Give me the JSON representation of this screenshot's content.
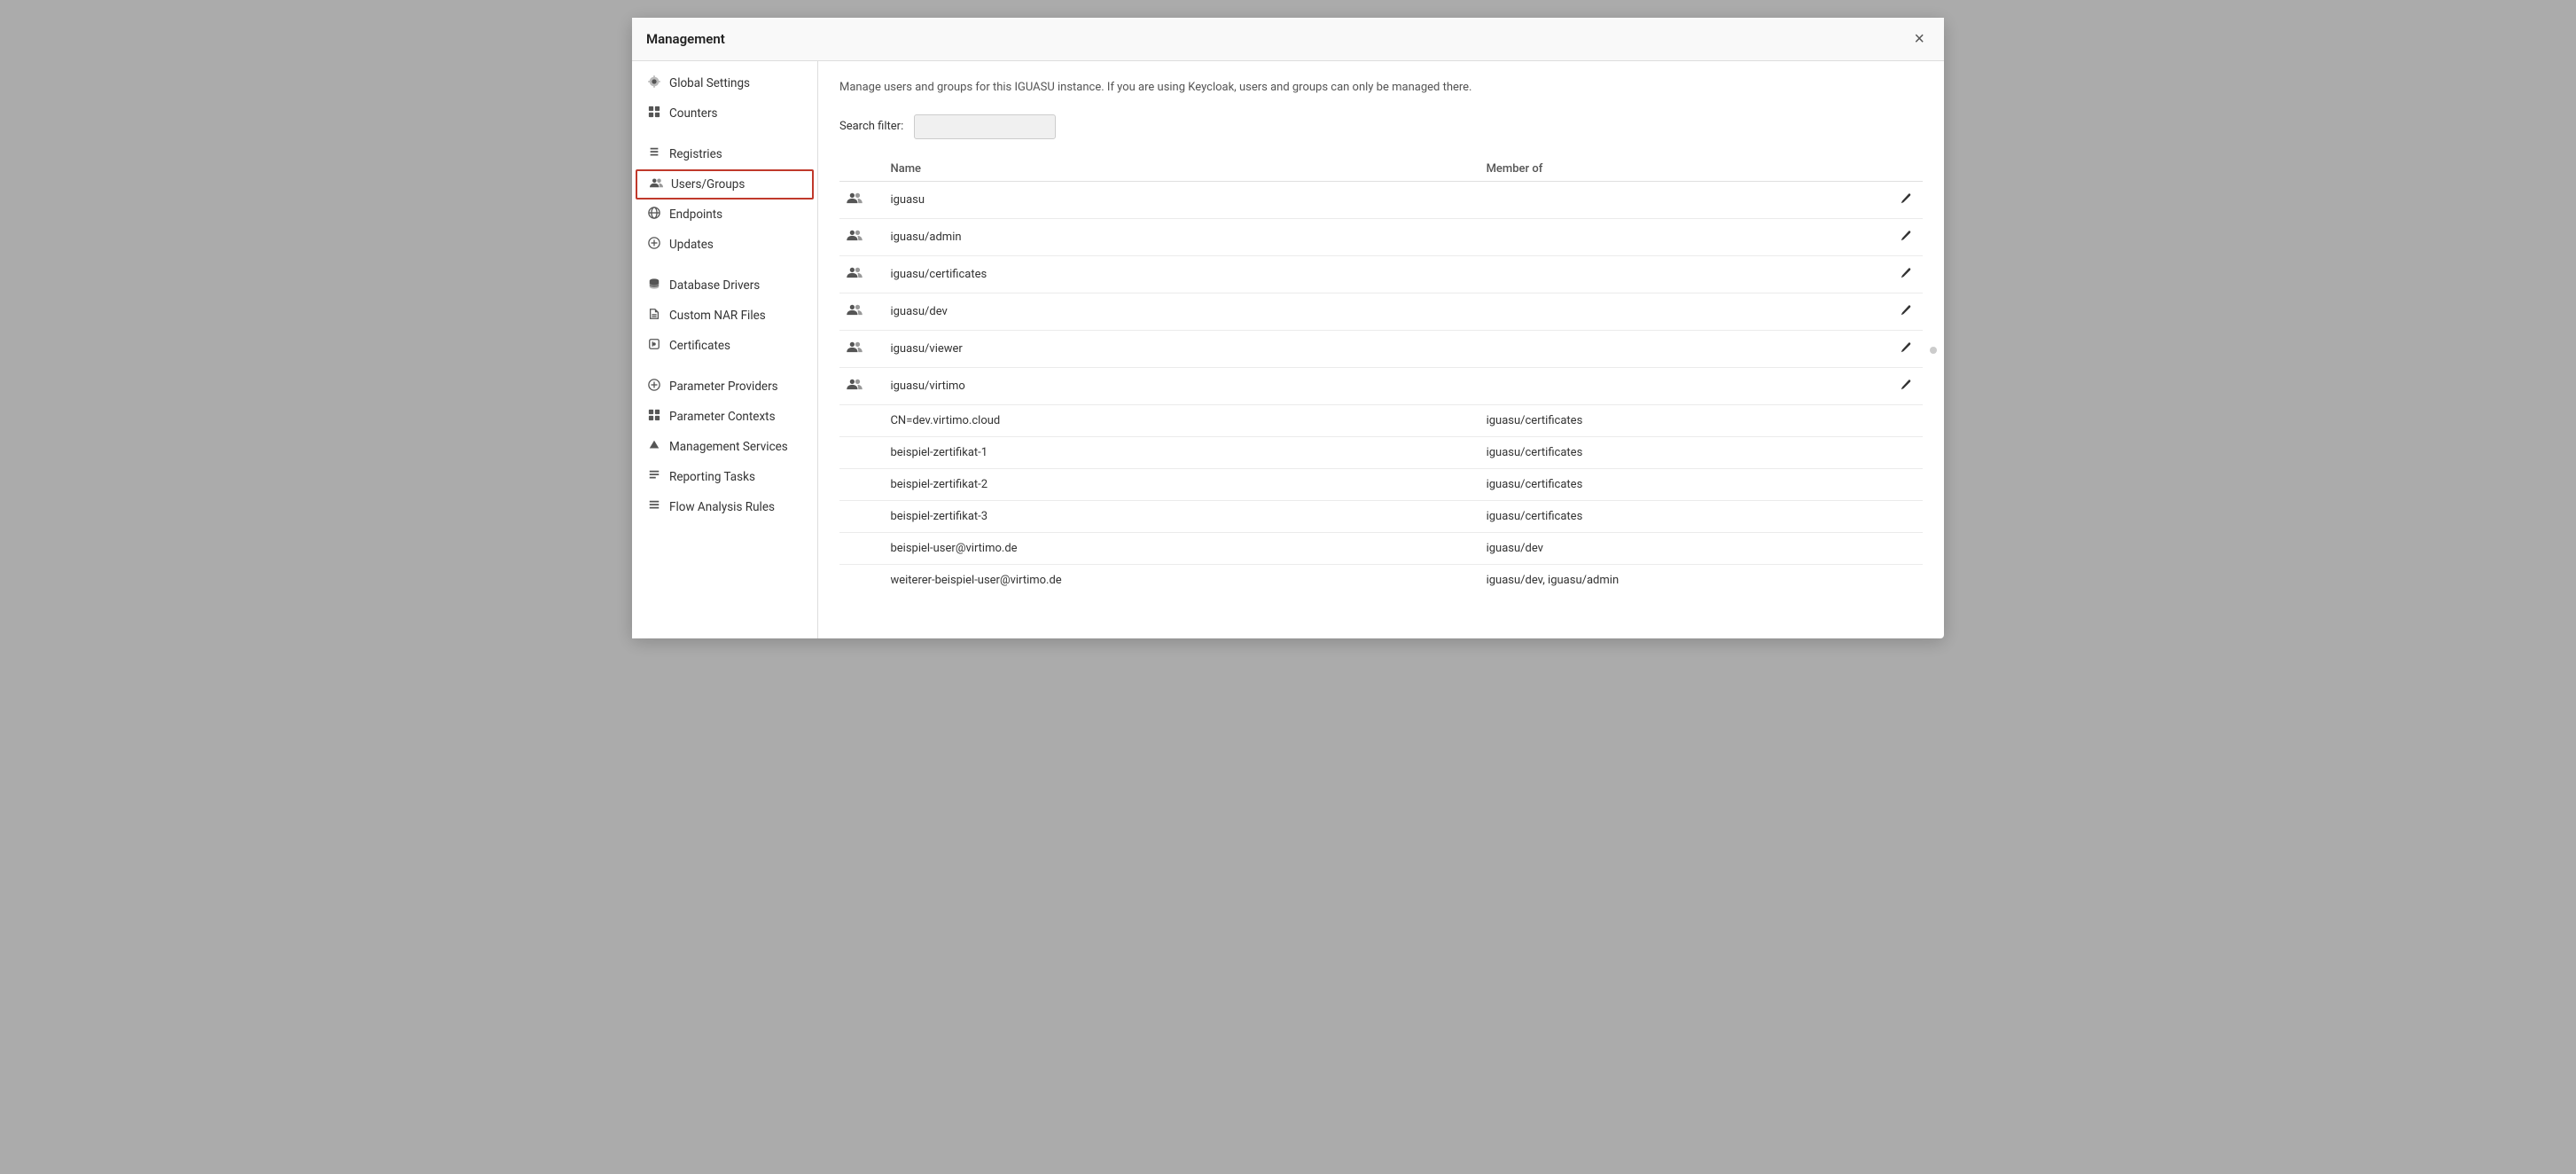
{
  "modal": {
    "title": "Management",
    "close_label": "×"
  },
  "sidebar": {
    "items": [
      {
        "id": "global-settings",
        "label": "Global Settings",
        "icon": "⚙",
        "active": false
      },
      {
        "id": "counters",
        "label": "Counters",
        "icon": "⊞",
        "active": false
      },
      {
        "id": "divider1",
        "type": "divider"
      },
      {
        "id": "registries",
        "label": "Registries",
        "icon": "⚑",
        "active": false
      },
      {
        "id": "users-groups",
        "label": "Users/Groups",
        "icon": "👥",
        "active": true
      },
      {
        "id": "endpoints",
        "label": "Endpoints",
        "icon": "🌐",
        "active": false
      },
      {
        "id": "updates",
        "label": "Updates",
        "icon": "⊕",
        "active": false
      },
      {
        "id": "divider2",
        "type": "divider"
      },
      {
        "id": "database-drivers",
        "label": "Database Drivers",
        "icon": "☰",
        "active": false
      },
      {
        "id": "custom-nar-files",
        "label": "Custom NAR Files",
        "icon": "⊕",
        "active": false
      },
      {
        "id": "certificates",
        "label": "Certificates",
        "icon": "🔒",
        "active": false
      },
      {
        "id": "divider3",
        "type": "divider"
      },
      {
        "id": "parameter-providers",
        "label": "Parameter Providers",
        "icon": "⊕",
        "active": false
      },
      {
        "id": "parameter-contexts",
        "label": "Parameter Contexts",
        "icon": "#",
        "active": false
      },
      {
        "id": "management-services",
        "label": "Management Services",
        "icon": "▲",
        "active": false
      },
      {
        "id": "reporting-tasks",
        "label": "Reporting Tasks",
        "icon": "☰",
        "active": false
      },
      {
        "id": "flow-analysis-rules",
        "label": "Flow Analysis Rules",
        "icon": "☰",
        "active": false
      }
    ]
  },
  "main": {
    "description": "Manage users and groups for this IGUASU instance. If you are using Keycloak, users and groups can only be managed there.",
    "search": {
      "label": "Search filter:",
      "placeholder": ""
    },
    "table": {
      "col_name": "Name",
      "col_member": "Member of",
      "rows": [
        {
          "is_group": true,
          "name": "iguasu",
          "member_of": ""
        },
        {
          "is_group": true,
          "name": "iguasu/admin",
          "member_of": ""
        },
        {
          "is_group": true,
          "name": "iguasu/certificates",
          "member_of": ""
        },
        {
          "is_group": true,
          "name": "iguasu/dev",
          "member_of": ""
        },
        {
          "is_group": true,
          "name": "iguasu/viewer",
          "member_of": ""
        },
        {
          "is_group": true,
          "name": "iguasu/virtimo",
          "member_of": ""
        },
        {
          "is_group": false,
          "name": "CN=dev.virtimo.cloud",
          "member_of": "iguasu/certificates"
        },
        {
          "is_group": false,
          "name": "beispiel-zertifikat-1",
          "member_of": "iguasu/certificates"
        },
        {
          "is_group": false,
          "name": "beispiel-zertifikat-2",
          "member_of": "iguasu/certificates"
        },
        {
          "is_group": false,
          "name": "beispiel-zertifikat-3",
          "member_of": "iguasu/certificates"
        },
        {
          "is_group": false,
          "name": "beispiel-user@virtimo.de",
          "member_of": "iguasu/dev"
        },
        {
          "is_group": false,
          "name": "weiterer-beispiel-user@virtimo.de",
          "member_of": "iguasu/dev, iguasu/admin"
        }
      ]
    }
  }
}
